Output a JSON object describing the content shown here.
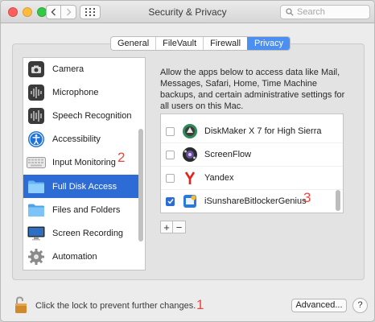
{
  "window": {
    "title": "Security & Privacy"
  },
  "search": {
    "placeholder": "Search"
  },
  "tabs": [
    {
      "label": "General",
      "active": false
    },
    {
      "label": "FileVault",
      "active": false
    },
    {
      "label": "Firewall",
      "active": false
    },
    {
      "label": "Privacy",
      "active": true
    }
  ],
  "sidebar": {
    "items": [
      {
        "label": "Camera",
        "icon": "camera-icon",
        "selected": false
      },
      {
        "label": "Microphone",
        "icon": "microphone-icon",
        "selected": false
      },
      {
        "label": "Speech Recognition",
        "icon": "speech-recognition-icon",
        "selected": false
      },
      {
        "label": "Accessibility",
        "icon": "accessibility-icon",
        "selected": false
      },
      {
        "label": "Input Monitoring",
        "icon": "keyboard-icon",
        "selected": false
      },
      {
        "label": "Full Disk Access",
        "icon": "folder-icon",
        "selected": true
      },
      {
        "label": "Files and Folders",
        "icon": "folder-icon",
        "selected": false
      },
      {
        "label": "Screen Recording",
        "icon": "display-icon",
        "selected": false
      },
      {
        "label": "Automation",
        "icon": "gear-icon",
        "selected": false
      }
    ]
  },
  "privacy": {
    "description": "Allow the apps below to access data like Mail, Messages, Safari, Home, Time Machine backups, and certain administrative settings for all users on this Mac.",
    "apps": [
      {
        "name": "DiskMaker X 7 for High Sierra",
        "checked": false,
        "icon": "diskmaker-icon"
      },
      {
        "name": "ScreenFlow",
        "checked": false,
        "icon": "screenflow-icon"
      },
      {
        "name": "Yandex",
        "checked": false,
        "icon": "yandex-icon"
      },
      {
        "name": "iSunshareBitlockerGenius",
        "checked": true,
        "icon": "isunshare-icon"
      }
    ],
    "add_label": "+",
    "remove_label": "−"
  },
  "footer": {
    "lock_text": "Click the lock to prevent further changes.",
    "advanced_label": "Advanced...",
    "help_label": "?"
  },
  "annotations": {
    "one": "1",
    "two": "2",
    "three": "3"
  },
  "colors": {
    "accent": "#2d6cd4",
    "annotation": "#e8473f"
  }
}
